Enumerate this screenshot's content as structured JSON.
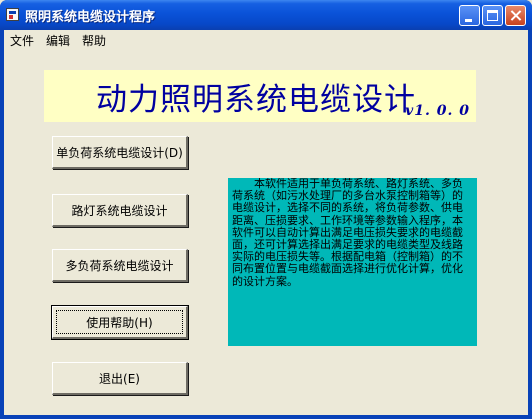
{
  "window": {
    "title": "照明系统电缆设计程序"
  },
  "menu": {
    "items": [
      "文件",
      "编辑",
      "帮助"
    ]
  },
  "header": {
    "title": "动力照明系统电缆设计",
    "version": "v1. 0. 0"
  },
  "buttons": {
    "single_load": "单负荷系统电缆设计(D)",
    "street_light": "路灯系统电缆设计",
    "multi_load": "多负荷系统电缆设计",
    "help": "使用帮助(H)",
    "exit": "退出(E)"
  },
  "description": "本软件适用于单负荷系统、路灯系统、多负荷系统（如污水处理厂的多台水泵控制箱等）的电缆设计，选择不同的系统，将负荷参数、供电距离、压损要求、工作环境等参数输入程序，本软件可以自动计算出满足电压损失要求的电缆截面，还可计算选择出满足要求的电缆类型及线路实际的电压损失等。根据配电箱（控制箱）的不同布置位置与电缆截面选择进行优化计算，优化的设计方案。",
  "colors": {
    "title_bar": "#0a52d8",
    "header_background": "#ffffc4",
    "header_text": "#0000a0",
    "description_background": "#00b8b8",
    "dialog_background": "#ece9d8"
  },
  "icons": {
    "app": "app-window-icon",
    "minimize": "minimize-icon",
    "maximize": "maximize-icon",
    "close": "close-icon"
  }
}
